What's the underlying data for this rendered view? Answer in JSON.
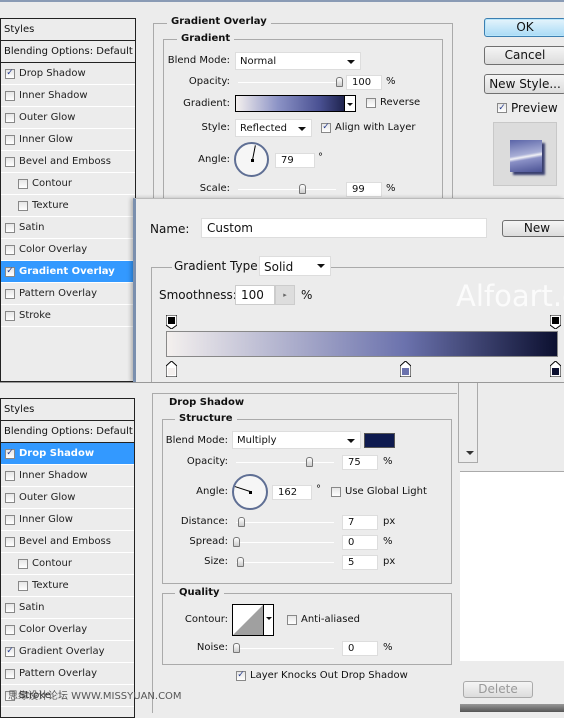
{
  "top_dialog": {
    "styles_header": "Styles",
    "blending_options": "Blending Options: Default",
    "items": [
      {
        "label": "Drop Shadow",
        "checked": true,
        "sub": false,
        "active": false
      },
      {
        "label": "Inner Shadow",
        "checked": false,
        "sub": false,
        "active": false
      },
      {
        "label": "Outer Glow",
        "checked": false,
        "sub": false,
        "active": false
      },
      {
        "label": "Inner Glow",
        "checked": false,
        "sub": false,
        "active": false
      },
      {
        "label": "Bevel and Emboss",
        "checked": false,
        "sub": false,
        "active": false
      },
      {
        "label": "Contour",
        "checked": false,
        "sub": true,
        "active": false
      },
      {
        "label": "Texture",
        "checked": false,
        "sub": true,
        "active": false
      },
      {
        "label": "Satin",
        "checked": false,
        "sub": false,
        "active": false
      },
      {
        "label": "Color Overlay",
        "checked": false,
        "sub": false,
        "active": false
      },
      {
        "label": "Gradient Overlay",
        "checked": true,
        "sub": false,
        "active": true
      },
      {
        "label": "Pattern Overlay",
        "checked": false,
        "sub": false,
        "active": false
      },
      {
        "label": "Stroke",
        "checked": false,
        "sub": false,
        "active": false
      }
    ],
    "section_title": "Gradient Overlay",
    "subsection_title": "Gradient",
    "blend_mode_label": "Blend Mode:",
    "blend_mode_value": "Normal",
    "opacity_label": "Opacity:",
    "opacity_value": "100",
    "opacity_unit": "%",
    "opacity_fraction": 1.0,
    "gradient_label": "Gradient:",
    "reverse_label": "Reverse",
    "reverse_checked": false,
    "style_label": "Style:",
    "style_value": "Reflected",
    "align_label": "Align with Layer",
    "align_checked": true,
    "angle_label": "Angle:",
    "angle_value": "79",
    "angle_degrees": 79,
    "degree_unit": "°",
    "scale_label": "Scale:",
    "scale_value": "99",
    "scale_unit": "%",
    "scale_fraction": 0.66,
    "buttons": {
      "ok": "OK",
      "cancel": "Cancel",
      "new_style": "New Style..."
    },
    "preview_label": "Preview",
    "preview_checked": true
  },
  "gradient_editor": {
    "name_label": "Name:",
    "name_value": "Custom",
    "new_button": "New",
    "gradient_type_label": "Gradient Type:",
    "gradient_type_value": "Solid",
    "smoothness_label": "Smoothness:",
    "smoothness_value": "100",
    "smoothness_unit": "%",
    "watermark": "Alfoart.com",
    "color_stops": [
      {
        "position": 0,
        "color": "#f4f0ee"
      },
      {
        "position": 0.61,
        "color": "#6b72ad"
      },
      {
        "position": 1,
        "color": "#0c1030"
      }
    ],
    "opacity_stops": [
      {
        "position": 0
      },
      {
        "position": 1
      }
    ]
  },
  "bottom_dialog": {
    "styles_header": "Styles",
    "blending_options": "Blending Options: Default",
    "items": [
      {
        "label": "Drop Shadow",
        "checked": true,
        "sub": false,
        "active": true
      },
      {
        "label": "Inner Shadow",
        "checked": false,
        "sub": false,
        "active": false
      },
      {
        "label": "Outer Glow",
        "checked": false,
        "sub": false,
        "active": false
      },
      {
        "label": "Inner Glow",
        "checked": false,
        "sub": false,
        "active": false
      },
      {
        "label": "Bevel and Emboss",
        "checked": false,
        "sub": false,
        "active": false
      },
      {
        "label": "Contour",
        "checked": false,
        "sub": true,
        "active": false
      },
      {
        "label": "Texture",
        "checked": false,
        "sub": true,
        "active": false
      },
      {
        "label": "Satin",
        "checked": false,
        "sub": false,
        "active": false
      },
      {
        "label": "Color Overlay",
        "checked": false,
        "sub": false,
        "active": false
      },
      {
        "label": "Gradient Overlay",
        "checked": true,
        "sub": false,
        "active": false
      },
      {
        "label": "Pattern Overlay",
        "checked": false,
        "sub": false,
        "active": false
      },
      {
        "label": "Stroke",
        "checked": false,
        "sub": false,
        "active": false
      }
    ],
    "section_title": "Drop Shadow",
    "structure_title": "Structure",
    "blend_mode_label": "Blend Mode:",
    "blend_mode_value": "Multiply",
    "shadow_color": "#0e1a4f",
    "opacity_label": "Opacity:",
    "opacity_value": "75",
    "opacity_unit": "%",
    "opacity_fraction": 0.75,
    "angle_label": "Angle:",
    "angle_value": "162",
    "angle_degrees": 162,
    "degree_unit": "°",
    "global_light_label": "Use Global Light",
    "global_light_checked": false,
    "distance_label": "Distance:",
    "distance_value": "7",
    "distance_unit": "px",
    "spread_label": "Spread:",
    "spread_value": "0",
    "spread_unit": "%",
    "size_label": "Size:",
    "size_value": "5",
    "size_unit": "px",
    "quality_title": "Quality",
    "contour_label": "Contour:",
    "anti_aliased_label": "Anti-aliased",
    "anti_aliased_checked": false,
    "noise_label": "Noise:",
    "noise_value": "0",
    "noise_unit": "%",
    "knockout_label": "Layer Knocks Out Drop Shadow",
    "knockout_checked": true,
    "delete_button": "Delete"
  },
  "watermark_footer": "思缘设计论坛  WWW.MISSYUAN.COM"
}
